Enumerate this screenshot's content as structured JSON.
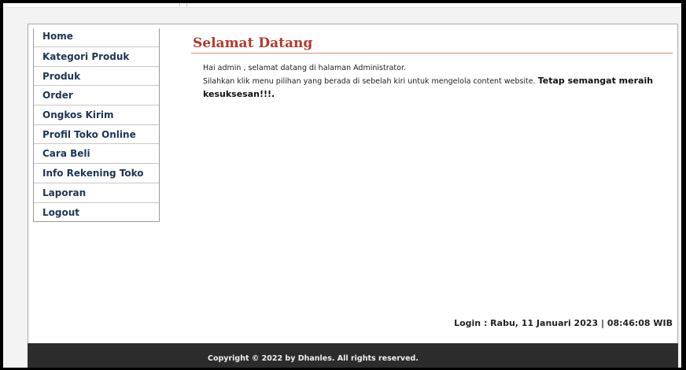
{
  "sidebar": {
    "items": [
      {
        "label": "Home"
      },
      {
        "label": "Kategori Produk"
      },
      {
        "label": "Produk"
      },
      {
        "label": "Order"
      },
      {
        "label": "Ongkos Kirim"
      },
      {
        "label": "Profil Toko Online"
      },
      {
        "label": "Cara Beli"
      },
      {
        "label": "Info Rekening Toko"
      },
      {
        "label": "Laporan"
      },
      {
        "label": "Logout"
      }
    ]
  },
  "main": {
    "title": "Selamat Datang",
    "greeting": "Hai admin , selamat datang di halaman Administrator.",
    "instruction": "Silahkan klik menu pilihan yang berada di sebelah kiri untuk mengelola content website.",
    "motivation": "Tetap semangat meraih kesuksesan!!!."
  },
  "login_info": "Login : Rabu, 11 Januari 2023 | 08:46:08 WIB",
  "footer": {
    "copyright": "Copyright © 2022 by Dhanles. All rights reserved."
  },
  "colors": {
    "title": "#b33a2e",
    "menu_text": "#1d3557",
    "footer_bg": "#2c2c2c"
  }
}
